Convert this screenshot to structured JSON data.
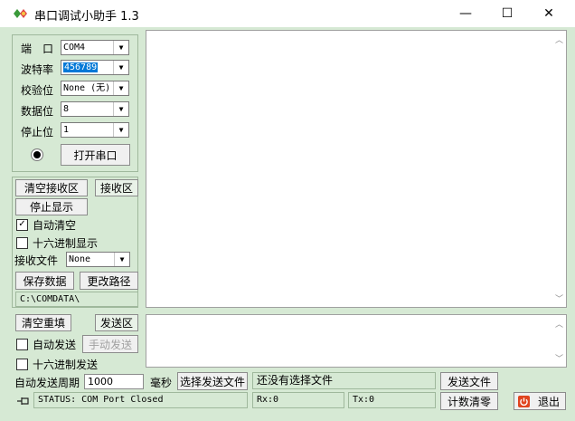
{
  "window": {
    "title": "串口调试小助手 1.3",
    "minimize_glyph": "—",
    "maximize_glyph": "☐",
    "close_glyph": "✕"
  },
  "serial": {
    "port_label": "端　口",
    "port_value": "COM4",
    "baud_label": "波特率",
    "baud_value": "456789",
    "parity_label": "校验位",
    "parity_value": "None (无)",
    "databits_label": "数据位",
    "databits_value": "8",
    "stopbits_label": "停止位",
    "stopbits_value": "1",
    "open_button": "打开串口",
    "led_color": "#000000"
  },
  "receive": {
    "clear_button": "清空接收区",
    "area_button": "接收区",
    "stop_display_button": "停止显示",
    "auto_clear_label": "自动清空",
    "auto_clear_checked": true,
    "hex_display_label": "十六进制显示",
    "hex_display_checked": false,
    "file_label": "接收文件",
    "file_value": "None",
    "save_button": "保存数据",
    "change_path_button": "更改路径",
    "path": "C:\\COMDATA\\"
  },
  "send": {
    "clear_button": "清空重填",
    "area_button": "发送区",
    "auto_send_label": "自动发送",
    "auto_send_checked": false,
    "manual_send_button": "手动发送",
    "hex_send_label": "十六进制发送",
    "hex_send_checked": false,
    "period_label": "自动发送周期",
    "period_value": "1000",
    "ms_label": "毫秒",
    "select_file_button": "选择发送文件",
    "file_status": "还没有选择文件",
    "send_file_button": "发送文件"
  },
  "statusbar": {
    "status": "STATUS: COM Port Closed",
    "rx": "Rx:0",
    "tx": "Tx:0",
    "reset_count_button": "计数清零",
    "exit_button": "退出"
  },
  "icons": {
    "app": "app-logo-icon",
    "pin": "pin-icon",
    "exit": "exit-power-icon"
  }
}
